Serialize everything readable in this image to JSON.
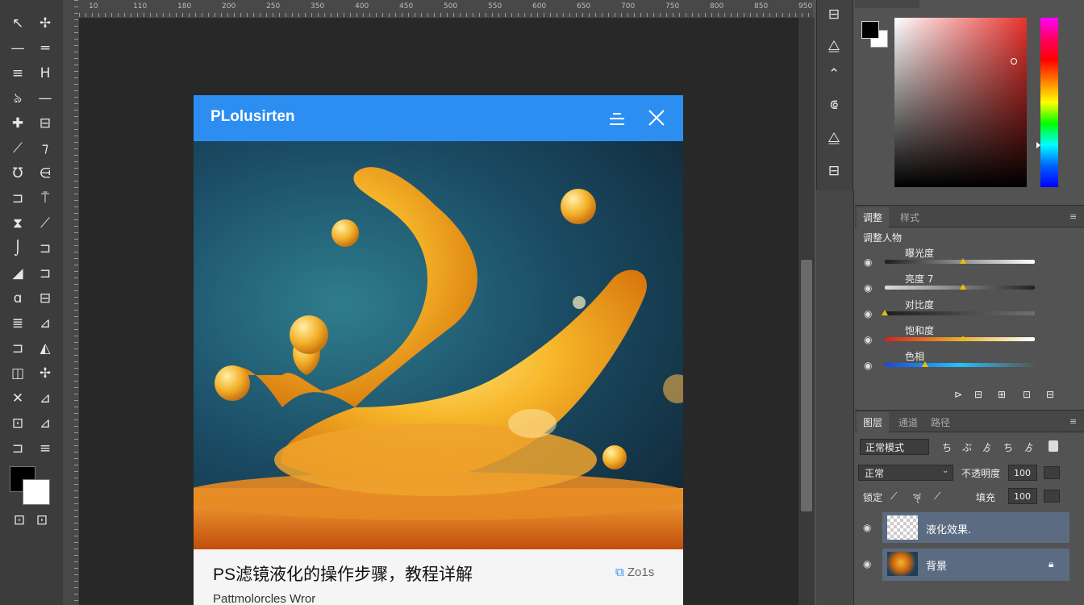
{
  "toolbar": {
    "tools": [
      [
        "↖",
        "✢"
      ],
      [
        "—",
        "═"
      ],
      [
        "≡",
        "H"
      ],
      [
        "ঌ",
        "—"
      ],
      [
        "✚",
        "⊟"
      ],
      [
        "⟋",
        "⁊"
      ],
      [
        "Ʊ",
        "⋳"
      ],
      [
        "⊐",
        "⍑"
      ],
      [
        "⧗",
        "⟋"
      ],
      [
        "⌡",
        "⊐"
      ],
      [
        "◢",
        "⊐"
      ],
      [
        "ɑ",
        "⊟"
      ],
      [
        "≣",
        "⊿"
      ],
      [
        "⊐",
        "◭"
      ],
      [
        "◫",
        "✢"
      ],
      [
        "✕",
        "⊿"
      ],
      [
        "⊡",
        "⊿"
      ],
      [
        "⊐",
        "≡"
      ]
    ],
    "bottom_icons": [
      "⊡",
      "⊡"
    ]
  },
  "ruler": {
    "numbers": [
      "10",
      "110",
      "180",
      "200",
      "250",
      "350",
      "400",
      "450",
      "500",
      "550",
      "600",
      "650",
      "700",
      "750",
      "800",
      "850",
      "950"
    ]
  },
  "dialog": {
    "title": "PLolusirten",
    "caption": "PS滤镜液化的操作步骤，教程详解",
    "subtitle": "Pattmolorcles Wror",
    "tag": "Zo1s",
    "tag_icon": "link-icon"
  },
  "right_icons": [
    "⊟",
    "⧋",
    "⌃",
    "⟃",
    "⧋",
    "⊟"
  ],
  "color_panel": {
    "foreground": "#000000",
    "background": "#ffffff",
    "hue_colors": [
      "#ff00ff",
      "#ff0000",
      "#ffff00",
      "#00ff00",
      "#00ffff",
      "#0000ff"
    ]
  },
  "adjust_panel": {
    "tabs": [
      "调整",
      "样式"
    ],
    "header": "调整人物",
    "sliders": [
      {
        "label": "曝光度",
        "value": 0.52
      },
      {
        "label": "亮度 7",
        "value": 0.52
      },
      {
        "label": "对比度",
        "value": 0.0
      },
      {
        "label": "饱和度",
        "value": 0.52
      },
      {
        "label": "色相",
        "value": 0.27
      }
    ],
    "footer_icons": [
      "⊳",
      "⊟",
      "⊞",
      "⊡",
      "⊟"
    ]
  },
  "layers_panel": {
    "tabs": [
      "图层",
      "通道",
      "路径"
    ],
    "blend_mode": "正常模式",
    "opacity_label": "不透明度",
    "fill_label": "填充",
    "lock_label": "锁定",
    "row1_icons": [
      "ち",
      "ぶ",
      "ゟ",
      "ち",
      "ゟ"
    ],
    "row3_icons": [
      "⟋",
      "ৠ",
      "⟋"
    ],
    "layers": [
      {
        "name": "液化效果.",
        "type": "transparent"
      },
      {
        "name": "背景",
        "type": "image"
      }
    ]
  }
}
